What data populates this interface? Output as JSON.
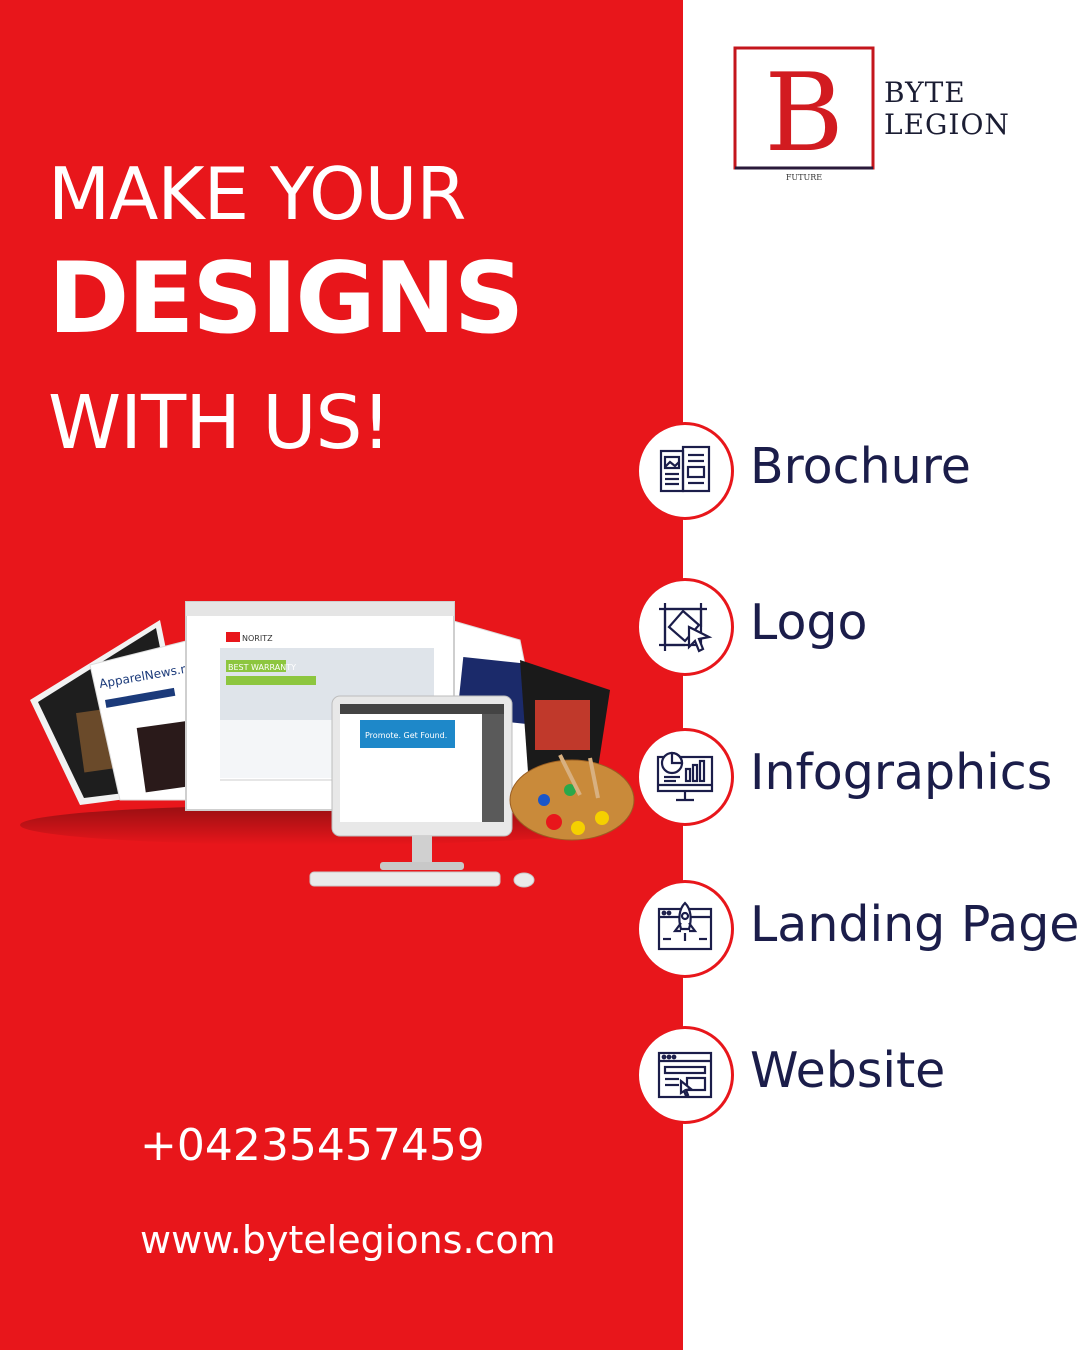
{
  "headline": {
    "line1": "MAKE YOUR",
    "line2": "DESIGNS",
    "line3": "WITH US!"
  },
  "brand": {
    "logo_letter": "B",
    "name_line1": "BYTE",
    "name_line2": "LEGION",
    "tagline": "FUTURE"
  },
  "services": [
    {
      "label": "Brochure",
      "icon": "brochure-icon"
    },
    {
      "label": "Logo",
      "icon": "logo-design-icon"
    },
    {
      "label": "Infographics",
      "icon": "infographics-icon"
    },
    {
      "label": "Landing Page",
      "icon": "landing-page-icon"
    },
    {
      "label": "Website",
      "icon": "website-icon"
    }
  ],
  "contact": {
    "phone": "+04235457459",
    "website": "www.bytelegions.com"
  },
  "hero": {
    "screen_texts": [
      "NORITZ",
      "BEST WARRANTY",
      "Promote. Get Found.",
      "ApparelNews.net"
    ]
  },
  "colors": {
    "brand_red": "#e8161b",
    "navy_text": "#1b1d4a",
    "white": "#ffffff"
  }
}
